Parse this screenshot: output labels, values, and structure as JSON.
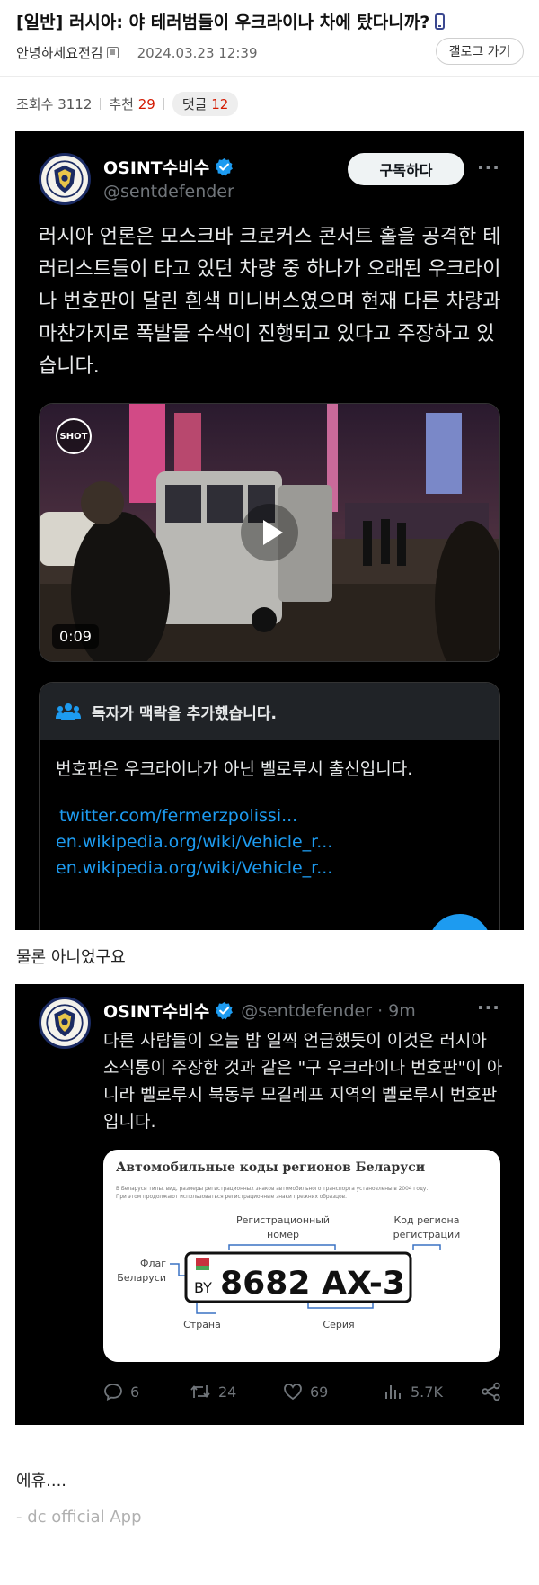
{
  "post": {
    "title": "[일반] 러시아: 야 테러범들이 우크라이나 차에 탔다니까?",
    "author": "안녕하세요전김",
    "date": "2024.03.23 12:39",
    "gallery_button": "갤로그 가기",
    "views_label": "조회수",
    "views": "3112",
    "recommend_label": "추천",
    "recommend": "29",
    "comments_label": "댓글",
    "comments": "12",
    "body_line_1": "물론 아니었구요",
    "body_line_2": "에휴....",
    "signature": "- dc official App"
  },
  "tweet1": {
    "account_name": "OSINT수비수",
    "handle": "@sentdefender",
    "subscribe_label": "구독하다",
    "more": "···",
    "text": "러시아 언론은 모스크바 크로커스 콘서트 홀을 공격한 테러리스트들이 타고 있던 차량 중 하나가 오래된 우크라이나 번호판이 달린 흰색 미니버스였으며 현재 다른 차량과 마찬가지로 폭발물 수색이 진행되고 있다고 주장하고 있습니다.",
    "video_duration": "0:09",
    "video_badge": "SHOT",
    "context_title": "독자가 맥락을 추가했습니다.",
    "context_text": "번호판은 우크라이나가 아닌 벨로루시 출신입니다.",
    "context_links": [
      "twitter.com/fermerzpolissi...",
      "en.wikipedia.org/wiki/Vehicle_r...",
      "en.wikipedia.org/wiki/Vehicle_r..."
    ]
  },
  "tweet2": {
    "account_name": "OSINT수비수",
    "handle_time": "@sentdefender · 9m",
    "more": "···",
    "text": "다른 사람들이 오늘 밤 일찍 언급했듯이 이것은 러시아 소식통이 주장한 것과 같은 \"구 우크라이나 번호판\"이 아니라 벨로루시 북동부 모길레프 지역의 벨로루시 번호판입니다.",
    "image": {
      "title": "Автомобильные коды регионов Беларуси",
      "fineprint_1": "В Беларуси типы, вид, размеры регистрационных знаков автомобильного транспорта установлены в 2004 году.",
      "fineprint_2": "При этом продолжают использоваться регистрационные знаки прежних образцов.",
      "label_reg_1": "Регистрационный",
      "label_reg_2": "номер",
      "label_code_1": "Код региона",
      "label_code_2": "регистрации",
      "label_flag_1": "Флаг",
      "label_flag_2": "Беларуси",
      "plate_country": "BY",
      "plate_number": "8682 AX-3",
      "label_country": "Страна",
      "label_series": "Серия"
    },
    "stats": {
      "replies": "6",
      "retweets": "24",
      "likes": "69",
      "views": "5.7K"
    }
  },
  "colors": {
    "comment_count_red": "#d31900",
    "twitter_blue": "#1d9bf0",
    "tweet_bg": "#000000"
  }
}
